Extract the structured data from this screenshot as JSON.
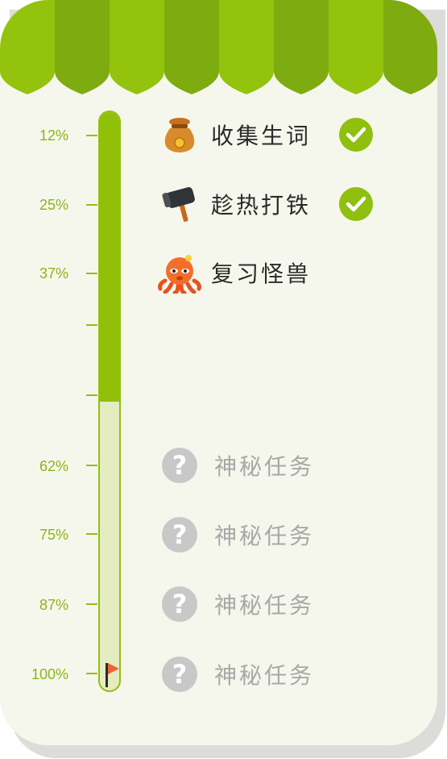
{
  "colors": {
    "awning_light": "#93c30c",
    "awning_dark": "#7eab0f",
    "progress_fill": "#90c108",
    "progress_track": "#e4ecc0",
    "check": "#8fbf0f",
    "locked": "#c8c8c8",
    "flag": "#f0613b"
  },
  "progress": {
    "fraction": 0.5
  },
  "ticks": [
    {
      "label": "12%"
    },
    {
      "label": "25%"
    },
    {
      "label": "37%"
    },
    {
      "label": ""
    },
    {
      "label": ""
    },
    {
      "label": "62%"
    },
    {
      "label": "75%"
    },
    {
      "label": "87%"
    },
    {
      "label": "100%"
    }
  ],
  "tasks": [
    {
      "label": "收集生词",
      "icon": "money-bag-icon",
      "completed": true
    },
    {
      "label": "趁热打铁",
      "icon": "hammer-icon",
      "completed": true
    },
    {
      "label": "复习怪兽",
      "icon": "octopus-monster-icon",
      "completed": false
    },
    {
      "label": "神秘任务",
      "icon": "question-mark-icon",
      "locked": true
    },
    {
      "label": "神秘任务",
      "icon": "question-mark-icon",
      "locked": true
    },
    {
      "label": "神秘任务",
      "icon": "question-mark-icon",
      "locked": true
    },
    {
      "label": "神秘任务",
      "icon": "question-mark-icon",
      "locked": true
    }
  ]
}
